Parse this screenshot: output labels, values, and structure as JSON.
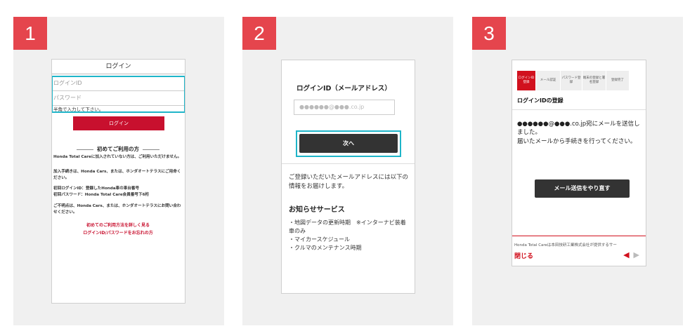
{
  "steps": [
    "1",
    "2",
    "3"
  ],
  "panel1": {
    "title": "ログイン",
    "login_id_placeholder": "ログインID",
    "password_placeholder": "パスワード",
    "hint": "半角で入力して下さい。",
    "login_button": "ログイン",
    "first_time_heading": "初めてご利用の方",
    "para1": "Honda Total Careに加入されていない方は、ご利用いただけません。",
    "para2": "加入手続きは、Honda Cars、または、ホンダオートテラスにご用命ください。",
    "initial_id": "初回ログインID：登録したHonda車の車台番号",
    "initial_password": "初回パスワード：Honda Total Care会員番号下6桁",
    "contact": "ご不明点は、Honda Cars、または、ホンダオートテラスにお問い合わせください。",
    "link_first_use": "初めてのご利用方法を詳しく見る",
    "link_forgot": "ログインID/パスワードをお忘れの方"
  },
  "panel2": {
    "title": "ログインID（メールアドレス）",
    "email_value": "●●●●●●@●●●.co.jp",
    "next_button": "次へ",
    "info_text": "ご登録いただいたメールアドレスには以下の情報をお届けします。",
    "service_heading": "お知らせサービス",
    "services": [
      "・地図データの更新時期　※インターナビ装着車のみ",
      "・マイカースケジュール",
      "・クルマのメンテナンス時期"
    ]
  },
  "panel3": {
    "steps": [
      {
        "label": "ログインID登録",
        "active": true
      },
      {
        "label": "メール認証",
        "active": false
      },
      {
        "label": "パスワード登録",
        "active": false
      },
      {
        "label": "端末の登録と署名登録",
        "active": false
      },
      {
        "label": "登録完了",
        "active": false
      }
    ],
    "title": "ログインIDの登録",
    "message1": "●●●●●●@●●●.co.jp宛にメールを送信しました。",
    "message2": "届いたメールから手続きを行ってください。",
    "resend_button": "メール送信をやり直す",
    "footer_text": "Honda Total Careは本田技研工業株式会社が提供するサー",
    "close_label": "閉じる",
    "prev_arrow": "◀",
    "next_arrow": "▶"
  }
}
